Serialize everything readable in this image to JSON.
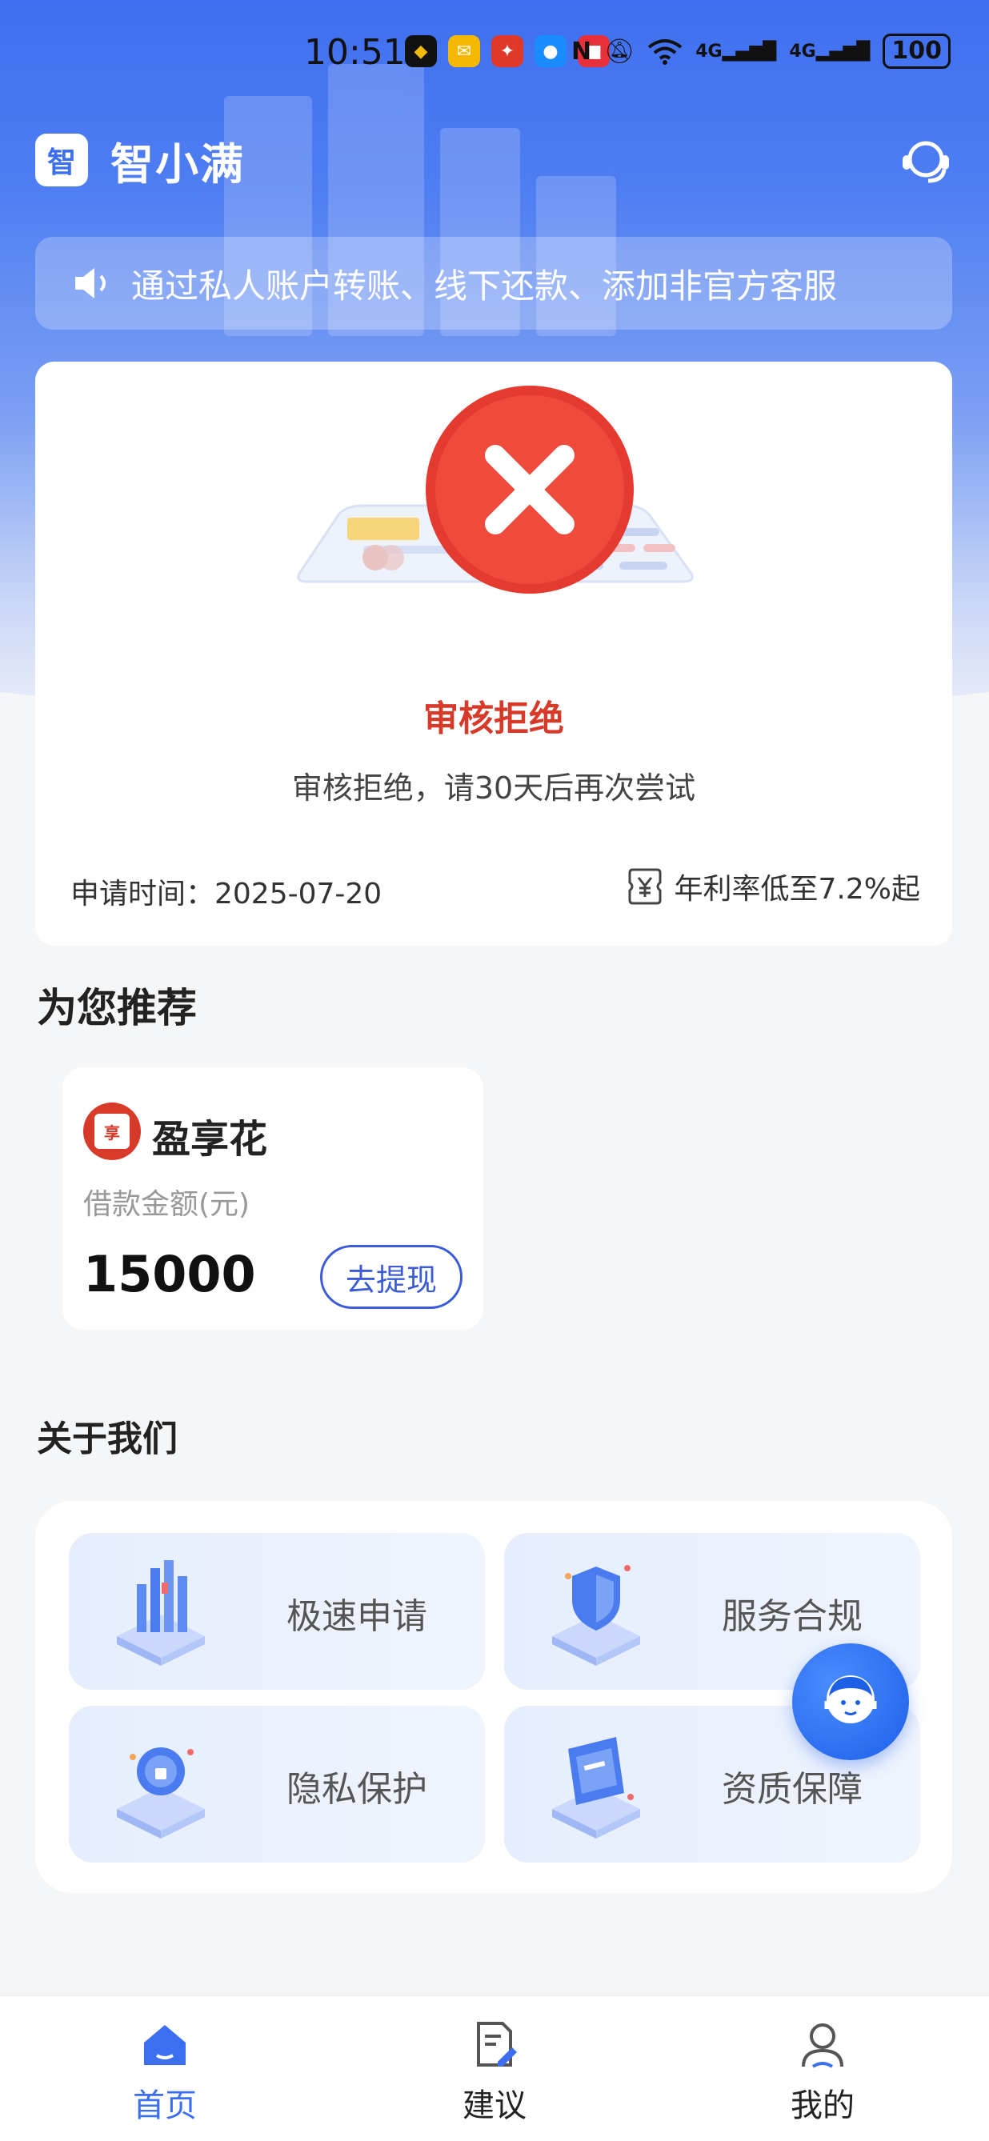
{
  "status_bar": {
    "time": "10:51",
    "network": "4G",
    "battery": "100"
  },
  "header": {
    "logo_char": "智",
    "title": "智小满"
  },
  "notice": {
    "text": "通过私人账户转账、线下还款、添加非官方客服"
  },
  "review": {
    "status_title": "审核拒绝",
    "status_desc": "审核拒绝，请30天后再次尝试",
    "apply_time": "申请时间：2025-07-20",
    "rate_text": "年利率低至7.2%起",
    "accent_color": "#d83a2a"
  },
  "recommend": {
    "section_title": "为您推荐",
    "product": {
      "logo_char": "享",
      "name": "盈享花",
      "amount_label": "借款金额(元)",
      "amount": "15000",
      "action_label": "去提现"
    }
  },
  "about": {
    "section_title": "关于我们",
    "items": [
      {
        "label": "极速申请",
        "icon": "fast-apply-icon"
      },
      {
        "label": "服务合规",
        "icon": "compliance-shield-icon"
      },
      {
        "label": "隐私保护",
        "icon": "privacy-lock-icon"
      },
      {
        "label": "资质保障",
        "icon": "qualification-certificate-icon"
      }
    ]
  },
  "tabbar": {
    "tabs": [
      {
        "label": "首页",
        "icon": "home-icon",
        "active": true
      },
      {
        "label": "建议",
        "icon": "feedback-icon",
        "active": false
      },
      {
        "label": "我的",
        "icon": "profile-icon",
        "active": false
      }
    ],
    "active_color": "#3b6ff0"
  }
}
